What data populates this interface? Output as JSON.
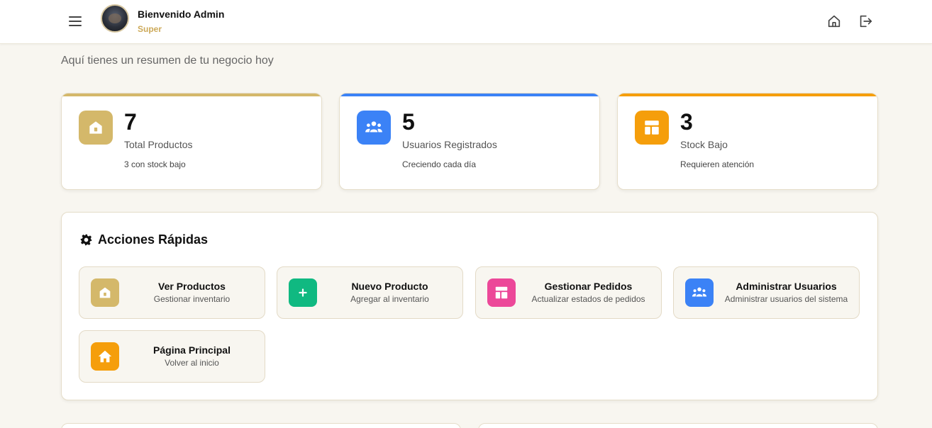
{
  "header": {
    "welcome": "Bienvenido Admin",
    "role": "Super",
    "icons": [
      "menu-icon",
      "home-icon",
      "logout-icon"
    ]
  },
  "subtitle": "Aquí tienes un resumen de tu negocio hoy",
  "stats": [
    {
      "value": "7",
      "label": "Total Productos",
      "note": "3 con stock bajo",
      "color": "#d4b86a",
      "icon": "box-icon"
    },
    {
      "value": "5",
      "label": "Usuarios Registrados",
      "note": "Creciendo cada día",
      "color": "#3b82f6",
      "icon": "users-icon"
    },
    {
      "value": "3",
      "label": "Stock Bajo",
      "note": "Requieren atención",
      "color": "#f59e0b",
      "icon": "layout-icon"
    }
  ],
  "quick_actions": {
    "title": "Acciones Rápidas",
    "icon": "gear-icon",
    "items": [
      {
        "title": "Ver Productos",
        "desc": "Gestionar inventario",
        "color": "#d4b86a",
        "icon": "box-icon"
      },
      {
        "title": "Nuevo Producto",
        "desc": "Agregar al inventario",
        "color": "#10b981",
        "icon": "plus-icon"
      },
      {
        "title": "Gestionar Pedidos",
        "desc": "Actualizar estados de pedidos",
        "color": "#ec4899",
        "icon": "layout-icon"
      },
      {
        "title": "Administrar Usuarios",
        "desc": "Administrar usuarios del sistema",
        "color": "#3b82f6",
        "icon": "users-icon"
      },
      {
        "title": "Página Principal",
        "desc": "Volver al inicio",
        "color": "#f59e0b",
        "icon": "home-icon"
      }
    ]
  }
}
